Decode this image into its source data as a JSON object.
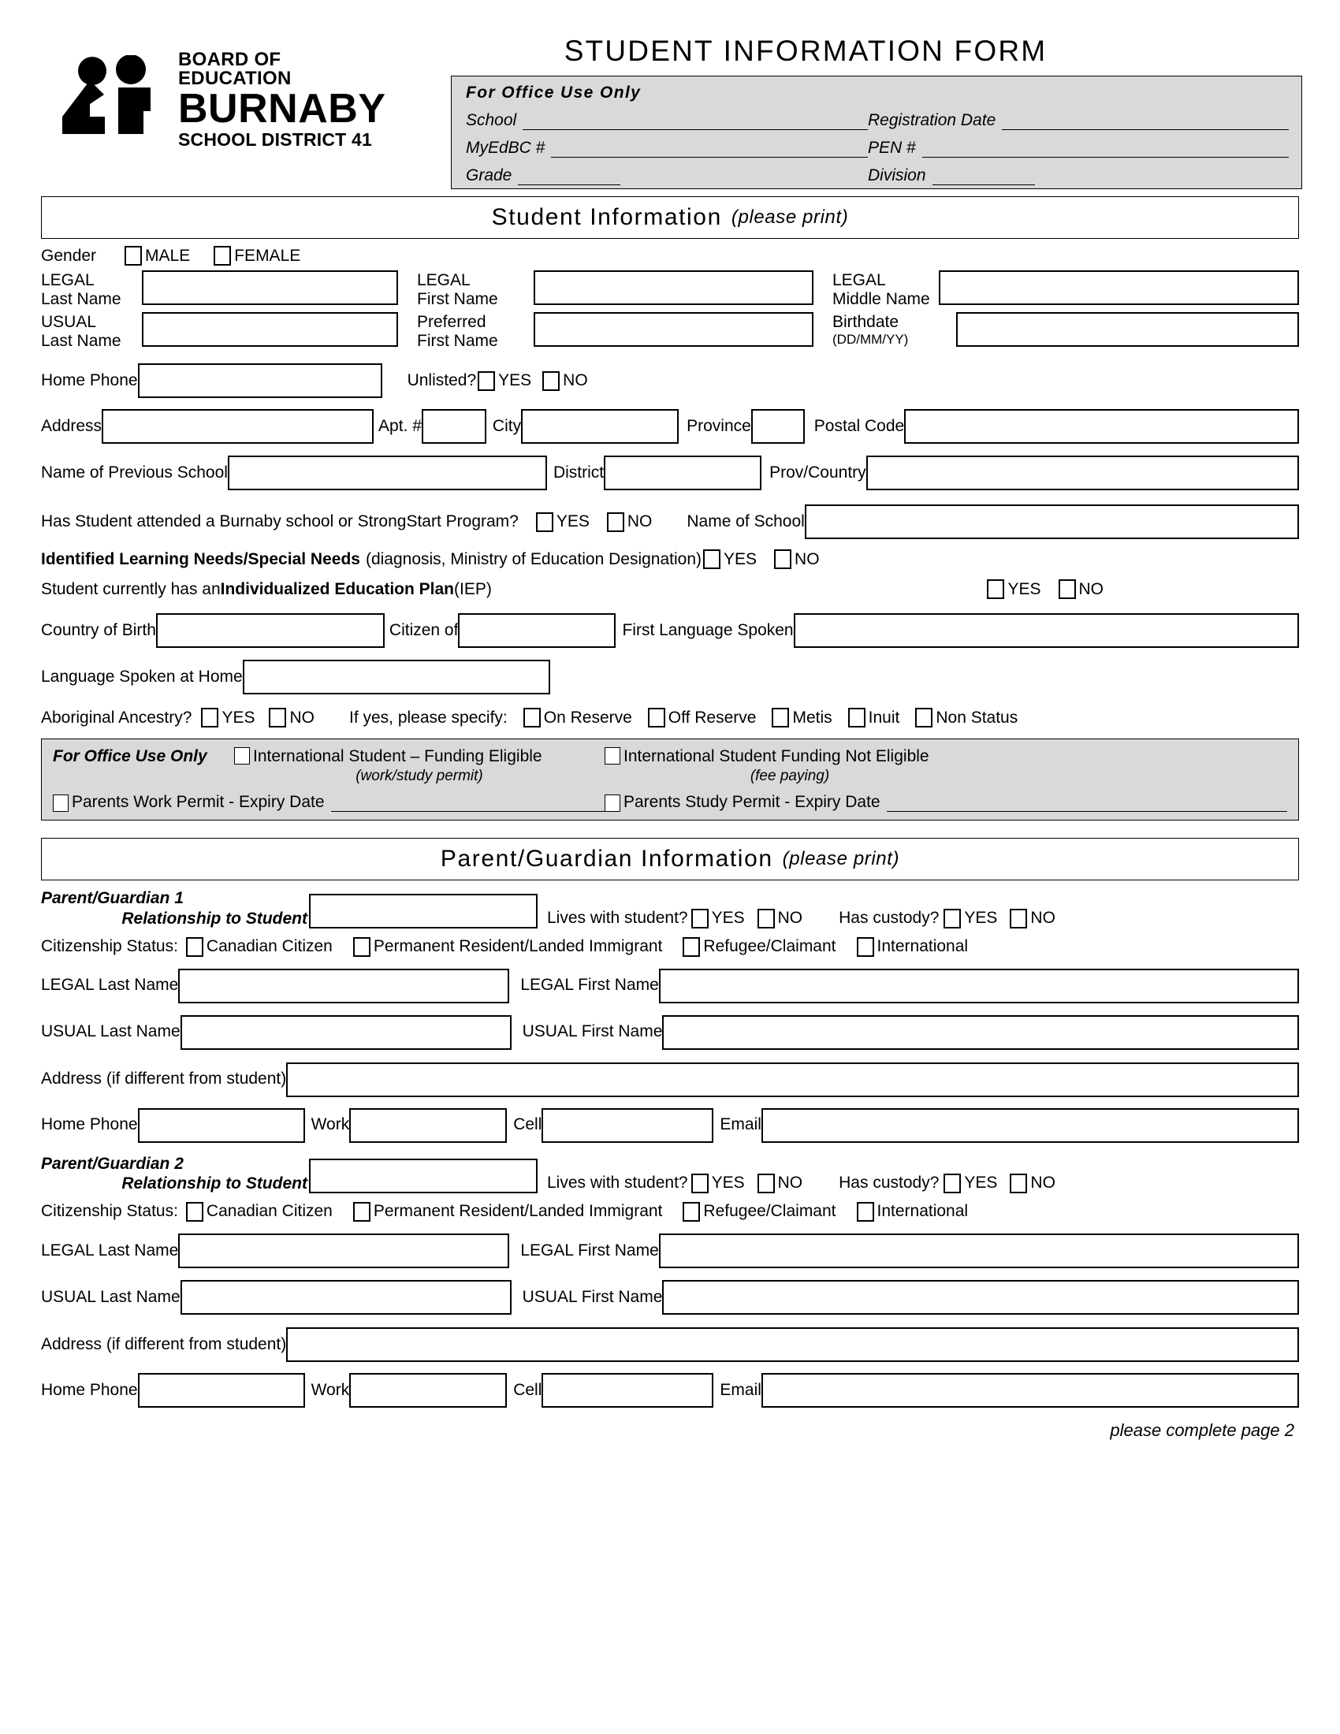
{
  "logo": {
    "line1": "BOARD OF EDUCATION",
    "line2": "BURNABY",
    "line3": "SCHOOL DISTRICT 41"
  },
  "title": "STUDENT INFORMATION FORM",
  "office_top": {
    "heading": "For Office Use Only",
    "school_label": "School",
    "registration_date_label": "Registration Date",
    "myedbc_label": "MyEdBC #",
    "pen_label": "PEN #",
    "grade_label": "Grade",
    "division_label": "Division"
  },
  "student_section": {
    "banner_main": "Student Information",
    "banner_sub": "(please print)",
    "gender_label": "Gender",
    "gender_male": "MALE",
    "gender_female": "FEMALE",
    "legal_last_l1": "LEGAL",
    "legal_last_l2": "Last Name",
    "legal_first_l1": "LEGAL",
    "legal_first_l2": "First Name",
    "legal_middle_l1": "LEGAL",
    "legal_middle_l2": "Middle Name",
    "usual_last_l1": "USUAL",
    "usual_last_l2": "Last Name",
    "preferred_first_l1": "Preferred",
    "preferred_first_l2": "First Name",
    "birthdate_l1": "Birthdate",
    "birthdate_l2": "(DD/MM/YY)",
    "home_phone_label": "Home Phone",
    "unlisted_label": "Unlisted?",
    "yes": "YES",
    "no": "NO",
    "address_label": "Address",
    "apt_label": "Apt. #",
    "city_label": "City",
    "province_label": "Province",
    "postal_label": "Postal Code",
    "prev_school_label": "Name of Previous School",
    "district_label": "District",
    "prov_country_label": "Prov/Country",
    "attended_question": "Has Student attended a Burnaby school or StrongStart Program?",
    "name_of_school_label": "Name of School",
    "special_needs_bold": "Identified Learning Needs/Special Needs",
    "special_needs_rest": "(diagnosis, Ministry of Education Designation)",
    "iep_pre": "Student currently has an ",
    "iep_bold": "Individualized Education Plan",
    "iep_post": " (IEP)",
    "country_of_birth_label": "Country of Birth",
    "citizen_of_label": "Citizen of",
    "first_language_label": "First Language Spoken",
    "home_language_label": "Language Spoken at Home",
    "aboriginal_label": "Aboriginal Ancestry?",
    "if_yes_specify": "If yes, please specify:",
    "on_reserve": "On Reserve",
    "off_reserve": "Off Reserve",
    "metis": "Metis",
    "inuit": "Inuit",
    "non_status": "Non Status"
  },
  "office_mid": {
    "heading": "For Office Use Only",
    "intl_eligible": "International Student – Funding Eligible",
    "intl_eligible_note": "(work/study permit)",
    "intl_not_eligible": "International Student Funding Not Eligible",
    "intl_not_eligible_note": "(fee paying)",
    "work_permit_label": "Parents Work Permit - Expiry Date",
    "study_permit_label": "Parents Study Permit - Expiry Date"
  },
  "parent_section": {
    "banner_main": "Parent/Guardian Information",
    "banner_sub": "(please print)",
    "lives_with_label": "Lives with student?",
    "custody_label": "Has custody?",
    "yes": "YES",
    "no": "NO",
    "citizenship_label": "Citizenship Status:",
    "citizenship_options": [
      "Canadian Citizen",
      "Permanent Resident/Landed Immigrant",
      "Refugee/Claimant",
      "International"
    ],
    "legal_last_label": "LEGAL Last Name",
    "legal_first_label": "LEGAL First Name",
    "usual_last_label": "USUAL Last Name",
    "usual_first_label": "USUAL First Name",
    "address_label": "Address (if different from student)",
    "home_phone_label": "Home Phone",
    "work_label": "Work",
    "cell_label": "Cell",
    "email_label": "Email",
    "guardians": [
      {
        "title_l1": "Parent/Guardian 1",
        "title_l2": "Relationship to Student"
      },
      {
        "title_l1": "Parent/Guardian 2",
        "title_l2": "Relationship to Student"
      }
    ]
  },
  "footer": "please complete page 2"
}
